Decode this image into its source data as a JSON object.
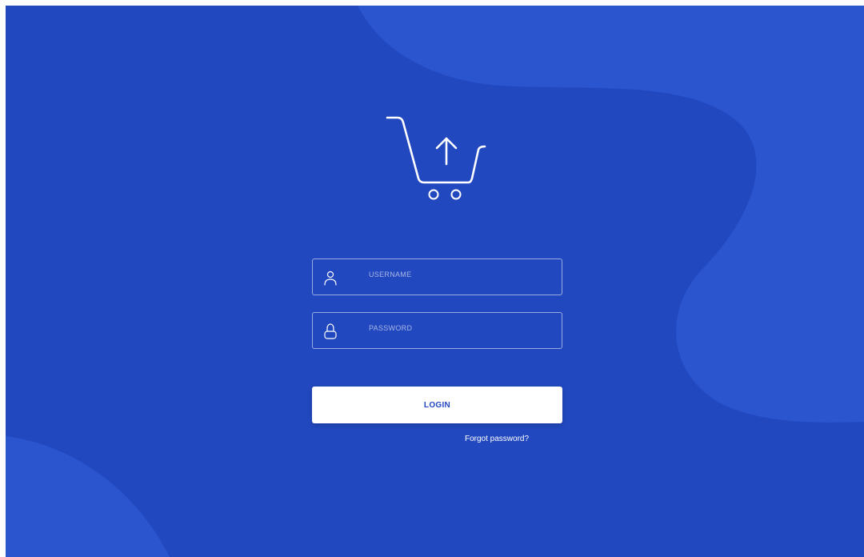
{
  "colors": {
    "background": "#2148bf",
    "blob": "#2a55cf",
    "button_background": "#ffffff",
    "button_text": "#2148bf"
  },
  "logo": {
    "icon": "shopping-cart-upload-icon"
  },
  "login_form": {
    "username": {
      "placeholder": "USERNAME",
      "value": "",
      "icon": "user-icon"
    },
    "password": {
      "placeholder": "PASSWORD",
      "value": "",
      "icon": "lock-icon"
    },
    "login_label": "LOGIN",
    "forgot_password_label": "Forgot password?"
  }
}
